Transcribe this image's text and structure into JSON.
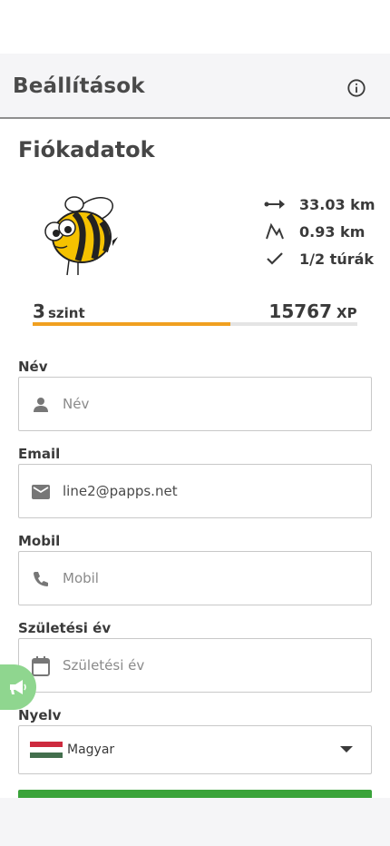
{
  "header": {
    "title": "Beállítások",
    "info_icon": "info-icon"
  },
  "account": {
    "title": "Fiókadatok",
    "avatar": "bee-mascot",
    "stats": [
      {
        "icon": "distance-icon",
        "value": "33.03 km"
      },
      {
        "icon": "elevation-icon",
        "value": "0.93 km"
      },
      {
        "icon": "check-icon",
        "value": "1/2 túrák"
      }
    ],
    "level": {
      "number": "3",
      "label": "szint",
      "progress": 0.61
    },
    "xp": {
      "value": "15767",
      "label": "XP"
    }
  },
  "form": {
    "name": {
      "label": "Név",
      "placeholder": "Név",
      "value": "",
      "icon": "person-icon"
    },
    "email": {
      "label": "Email",
      "value": "line2@papps.net",
      "icon": "mail-icon"
    },
    "phone": {
      "label": "Mobil",
      "placeholder": "Mobil",
      "value": "",
      "icon": "phone-icon"
    },
    "birth_year": {
      "label": "Születési év",
      "placeholder": "Születési év",
      "value": "",
      "icon": "calendar-icon"
    },
    "language": {
      "label": "Nyelv",
      "selected": "Magyar",
      "flag": "hungary-flag"
    }
  },
  "colors": {
    "accent_progress": "#f0a020",
    "primary_button": "#3aa33a",
    "fab": "#8fd68f"
  }
}
